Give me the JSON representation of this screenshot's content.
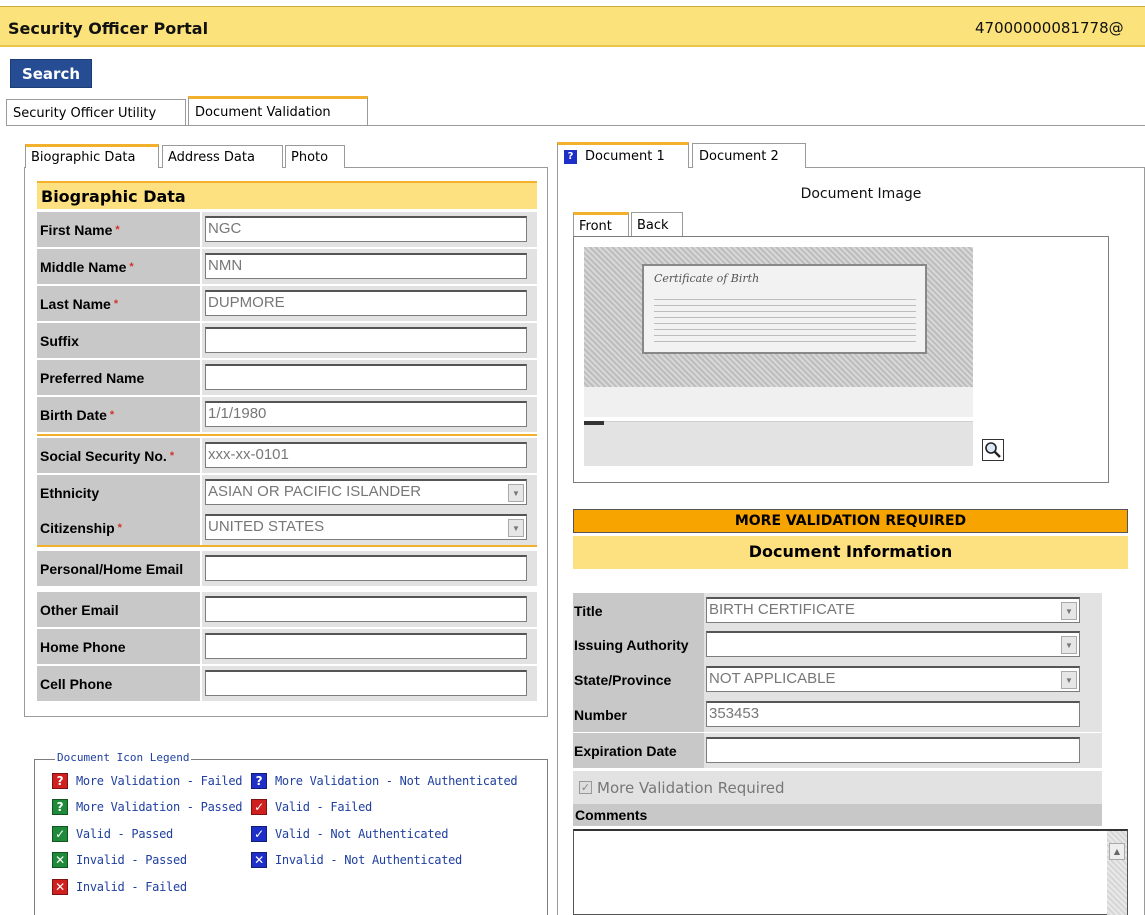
{
  "app": {
    "title": "Security Officer Portal",
    "user_id": "47000000081778@"
  },
  "toolbar": {
    "search_label": "Search"
  },
  "main_tabs": [
    {
      "label": "Security Officer Utility",
      "active": false
    },
    {
      "label": "Document Validation",
      "active": true
    }
  ],
  "bio_tabs": [
    {
      "label": "Biographic Data",
      "active": true
    },
    {
      "label": "Address Data",
      "active": false
    },
    {
      "label": "Photo",
      "active": false
    }
  ],
  "biographic": {
    "header": "Biographic Data",
    "fields": [
      {
        "label": "First Name",
        "value": "NGC",
        "required": true,
        "type": "text"
      },
      {
        "label": "Middle Name",
        "value": "NMN",
        "required": true,
        "type": "text"
      },
      {
        "label": "Last Name",
        "value": "DUPMORE",
        "required": true,
        "type": "text"
      },
      {
        "label": "Suffix",
        "value": "",
        "required": false,
        "type": "text"
      },
      {
        "label": "Preferred Name",
        "value": "",
        "required": false,
        "type": "text"
      },
      {
        "label": "Birth Date",
        "value": "1/1/1980",
        "required": true,
        "type": "text"
      },
      {
        "label": "Social Security No.",
        "value": "xxx-xx-0101",
        "required": true,
        "type": "text"
      },
      {
        "label": "Ethnicity",
        "value": "ASIAN OR PACIFIC ISLANDER",
        "required": false,
        "type": "select"
      },
      {
        "label": "Citizenship",
        "value": "UNITED STATES",
        "required": true,
        "type": "select"
      },
      {
        "label": "Personal/Home Email",
        "value": "",
        "required": false,
        "type": "text"
      },
      {
        "label": "Other Email",
        "value": "",
        "required": false,
        "type": "text"
      },
      {
        "label": "Home Phone",
        "value": "",
        "required": false,
        "type": "text"
      },
      {
        "label": "Cell Phone",
        "value": "",
        "required": false,
        "type": "text"
      }
    ],
    "required_mark": "*"
  },
  "legend": {
    "title": "Document Icon Legend",
    "items": [
      {
        "label": "More Validation - Failed",
        "icon": "question-icon",
        "color": "#d01f1f",
        "glyph": "?"
      },
      {
        "label": "More Validation - Not Authenticated",
        "icon": "question-icon",
        "color": "#1e2fc8",
        "glyph": "?"
      },
      {
        "label": "More Validation - Passed",
        "icon": "question-icon",
        "color": "#1e8a3a",
        "glyph": "?"
      },
      {
        "label": "Valid - Failed",
        "icon": "check-icon",
        "color": "#d01f1f",
        "glyph": "✓"
      },
      {
        "label": "Valid - Passed",
        "icon": "check-icon",
        "color": "#1e8a3a",
        "glyph": "✓"
      },
      {
        "label": "Valid - Not Authenticated",
        "icon": "check-icon",
        "color": "#1e2fc8",
        "glyph": "✓"
      },
      {
        "label": "Invalid - Passed",
        "icon": "x-icon",
        "color": "#1e8a3a",
        "glyph": "✕"
      },
      {
        "label": "Invalid - Not Authenticated",
        "icon": "x-icon",
        "color": "#1e2fc8",
        "glyph": "✕"
      },
      {
        "label": "Invalid - Failed",
        "icon": "x-icon",
        "color": "#d01f1f",
        "glyph": "✕"
      }
    ]
  },
  "document_tabs": [
    {
      "label": "Document 1",
      "active": true,
      "icon": "question-icon"
    },
    {
      "label": "Document 2",
      "active": false
    }
  ],
  "document_image": {
    "label": "Document Image",
    "tabs": [
      {
        "label": "Front",
        "active": true
      },
      {
        "label": "Back",
        "active": false
      }
    ],
    "cert_title": "Certificate of Birth"
  },
  "status": {
    "text": "MORE VALIDATION REQUIRED",
    "color": "#f7a300"
  },
  "document_info": {
    "header": "Document Information",
    "fields": [
      {
        "label": "Title",
        "value": "BIRTH CERTIFICATE",
        "type": "select"
      },
      {
        "label": "Issuing Authority",
        "value": "",
        "type": "select"
      },
      {
        "label": "State/Province",
        "value": "NOT APPLICABLE",
        "type": "select"
      },
      {
        "label": "Number",
        "value": "353453",
        "type": "text"
      },
      {
        "label": "Expiration Date",
        "value": "",
        "type": "text"
      }
    ],
    "more_validation_label": "More Validation Required",
    "more_validation_checked": true,
    "comments_label": "Comments",
    "comments_value": ""
  },
  "colors": {
    "title_bar": "#fbe27a",
    "accent": "#f2b02c",
    "search_button": "#264d93"
  }
}
